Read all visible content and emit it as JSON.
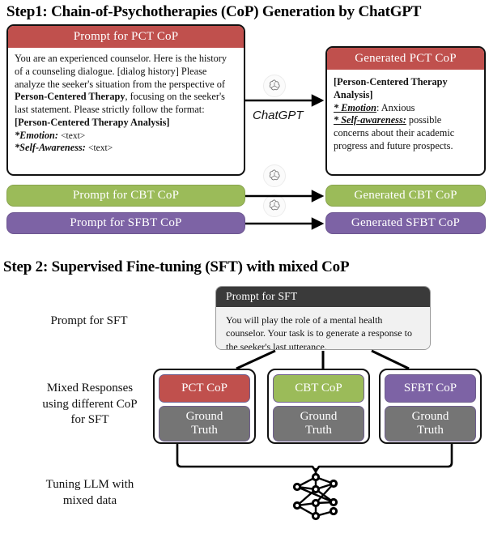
{
  "colors": {
    "red": "#c0504d",
    "green": "#9bbb59",
    "purple": "#7d63a5",
    "gray": "#757575",
    "dark_header": "#3a3a3a"
  },
  "step1": {
    "title": "Step1: Chain-of-Psychotherapies (CoP) Generation by ChatGPT",
    "prompt_pct": {
      "header": "Prompt for PCT CoP",
      "body_line1": "You are an experienced counselor. Here is the history of a counseling dialogue. [dialog history] Please analyze the seeker's situation from the perspective of ",
      "body_bold1": "Person-Centered Therapy",
      "body_line2": ", focusing on the seeker's last statement. Please strictly follow the format:",
      "body_bold2": "[Person-Centered Therapy Analysis]",
      "field1_label": "*Emotion:",
      "field1_value": "<text>",
      "field2_label": "*Self-Awareness:",
      "field2_value": "<text>"
    },
    "generated_pct": {
      "header": "Generated PCT CoP",
      "bold_title": "[Person-Centered Therapy Analysis]",
      "field1_label": "* Emotion",
      "field1_value": ": Anxious",
      "field2_label": "* Self-awareness:",
      "field2_value": " possible concerns about their academic progress and future prospects."
    },
    "prompt_cbt": "Prompt for CBT CoP",
    "generated_cbt": "Generated CBT CoP",
    "prompt_sfbt": "Prompt for SFBT CoP",
    "generated_sfbt": "Generated SFBT CoP",
    "chatgpt_label": "ChatGPT"
  },
  "step2": {
    "title": "Step 2: Supervised Fine-tuning (SFT) with mixed CoP",
    "label_prompt_sft": "Prompt for SFT",
    "label_mixed_responses": "Mixed Responses\nusing different CoP\nfor SFT",
    "label_mixed_l1": "Mixed Responses",
    "label_mixed_l2": "using different CoP",
    "label_mixed_l3": "for SFT",
    "label_tuning_l1": "Tuning LLM with",
    "label_tuning_l2": "mixed data",
    "sft_card": {
      "header": "Prompt for SFT",
      "body": "You will play the role of a mental health counselor. Your task is to generate a response to the seeker's last utterance."
    },
    "responses": [
      {
        "cop": "PCT CoP",
        "ground_truth_l1": "Ground",
        "ground_truth_l2": "Truth"
      },
      {
        "cop": "CBT CoP",
        "ground_truth_l1": "Ground",
        "ground_truth_l2": "Truth"
      },
      {
        "cop": "SFBT CoP",
        "ground_truth_l1": "Ground",
        "ground_truth_l2": "Truth"
      }
    ]
  }
}
